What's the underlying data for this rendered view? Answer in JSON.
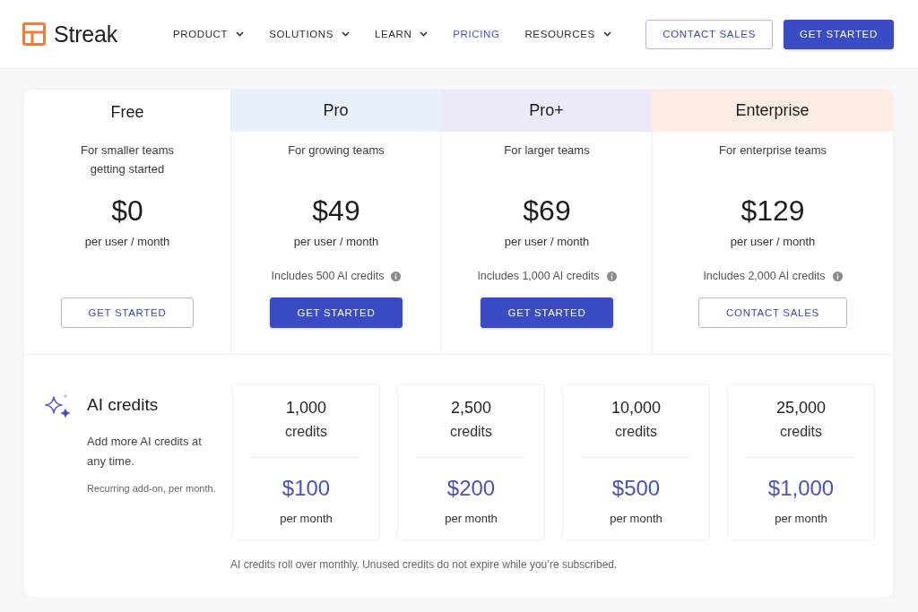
{
  "header": {
    "logo": {
      "name": "Streak"
    },
    "nav": [
      {
        "label": "PRODUCT",
        "kind": "menu",
        "selected": false
      },
      {
        "label": "SOLUTIONS",
        "kind": "menu",
        "selected": false
      },
      {
        "label": "LEARN",
        "kind": "menu",
        "selected": false
      },
      {
        "label": "PRICING",
        "kind": "link",
        "selected": true
      },
      {
        "label": "RESOURCES",
        "kind": "menu",
        "selected": false
      }
    ],
    "actions": [
      {
        "label": "CONTACT SALES",
        "kind": "outline"
      },
      {
        "label": "GET STARTED",
        "kind": "filled"
      }
    ]
  },
  "plans": [
    {
      "name": "Free",
      "description": "For smaller teams getting started",
      "price": "$0",
      "period": "per user / month",
      "button": {
        "label": "GET STARTED",
        "kind": "outline"
      }
    },
    {
      "name": "Pro",
      "color": "#e9effb",
      "description": "For growing teams",
      "price": "$49",
      "period": "per user / month",
      "credits": "Includes 500 AI credits",
      "button": {
        "label": "GET STARTED",
        "kind": "filled"
      }
    },
    {
      "name": "Pro+",
      "color": "#ece9f8",
      "description": "For larger teams",
      "price": "$69",
      "period": "per user / month",
      "credits": "Includes 1,000 AI credits",
      "button": {
        "label": "GET STARTED",
        "kind": "filled"
      }
    },
    {
      "name": "Enterprise",
      "color": "#fcece4",
      "description": "For enterprise teams",
      "price": "$129",
      "period": "per user / month",
      "credits": "Includes 2,000 AI credits",
      "button": {
        "label": "CONTACT SALES",
        "kind": "outline"
      }
    }
  ],
  "ai_credits": {
    "title": "AI credits",
    "description": "Add more AI credits at any time.",
    "note": "Recurring add-on, per month.",
    "packs": [
      {
        "amount": "1,000",
        "unit": "credits",
        "price": "$100",
        "period": "per month"
      },
      {
        "amount": "2,500",
        "unit": "credits",
        "price": "$200",
        "period": "per month"
      },
      {
        "amount": "10,000",
        "unit": "credits",
        "price": "$500",
        "period": "per month"
      },
      {
        "amount": "25,000",
        "unit": "credits",
        "price": "$1,000",
        "period": "per month"
      }
    ],
    "footnote": "AI credits roll over monthly. Unused credits do not expire while you’re subscribed."
  }
}
